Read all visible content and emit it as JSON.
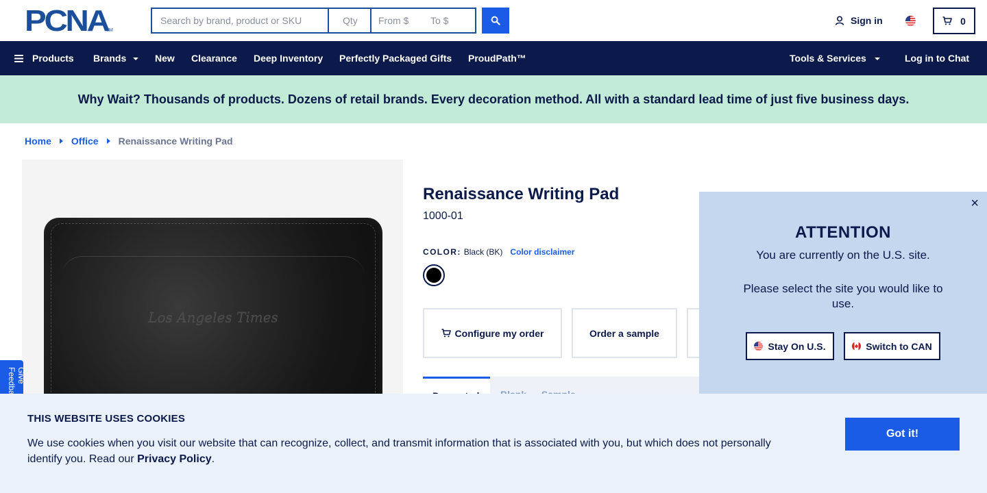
{
  "header": {
    "logo_text": "PCNA",
    "logo_tm": "TM",
    "search_placeholder": "Search by brand, product or SKU",
    "qty_placeholder": "Qty",
    "price_from_placeholder": "From $",
    "price_to_placeholder": "To $",
    "sign_in": "Sign in",
    "cart_count": "0"
  },
  "nav": {
    "products": "Products",
    "brands": "Brands",
    "new": "New",
    "clearance": "Clearance",
    "deep_inventory": "Deep Inventory",
    "gifts": "Perfectly Packaged Gifts",
    "proudpath": "ProudPath™",
    "tools": "Tools & Services",
    "chat": "Log in to Chat"
  },
  "promo": {
    "text": "Why Wait? Thousands of products. Dozens of retail brands. Every decoration method. All with a standard lead time of just five business days."
  },
  "breadcrumb": {
    "home": "Home",
    "office": "Office",
    "current": "Renaissance Writing Pad"
  },
  "product": {
    "title": "Renaissance Writing Pad",
    "sku": "1000-01",
    "color_label": "COLOR:",
    "color_value": "Black (BK)",
    "color_disclaimer": "Color disclaimer",
    "swatch_color": "#000000",
    "emboss_text": "Los Angeles Times",
    "configure_label": "Configure my order",
    "sample_label": "Order a sample",
    "tab_active": "Decorated",
    "tab_other": "Blank — Sample"
  },
  "feedback": {
    "label": "Give Feedback"
  },
  "attention": {
    "title": "ATTENTION",
    "line1": "You are currently on the U.S. site.",
    "line2": "Please select the site you would like to use.",
    "stay_label": "Stay On U.S.",
    "switch_label": "Switch to CAN"
  },
  "cookie": {
    "title": "THIS WEBSITE USES COOKIES",
    "text": "We use cookies when you visit our website that can recognize, collect, and transmit information that is associated with you, but which does not personally identify you. Read our",
    "policy_link": "Privacy Policy",
    "period": ".",
    "accept": "Got it!"
  },
  "colors": {
    "navy": "#0b1a4a",
    "brand_blue": "#1a5ce6",
    "logo_blue": "#1b4f9c",
    "promo_green": "#c1ebd6",
    "modal_blue": "#c5d6ef",
    "cookie_bg": "#eaf1fb"
  }
}
